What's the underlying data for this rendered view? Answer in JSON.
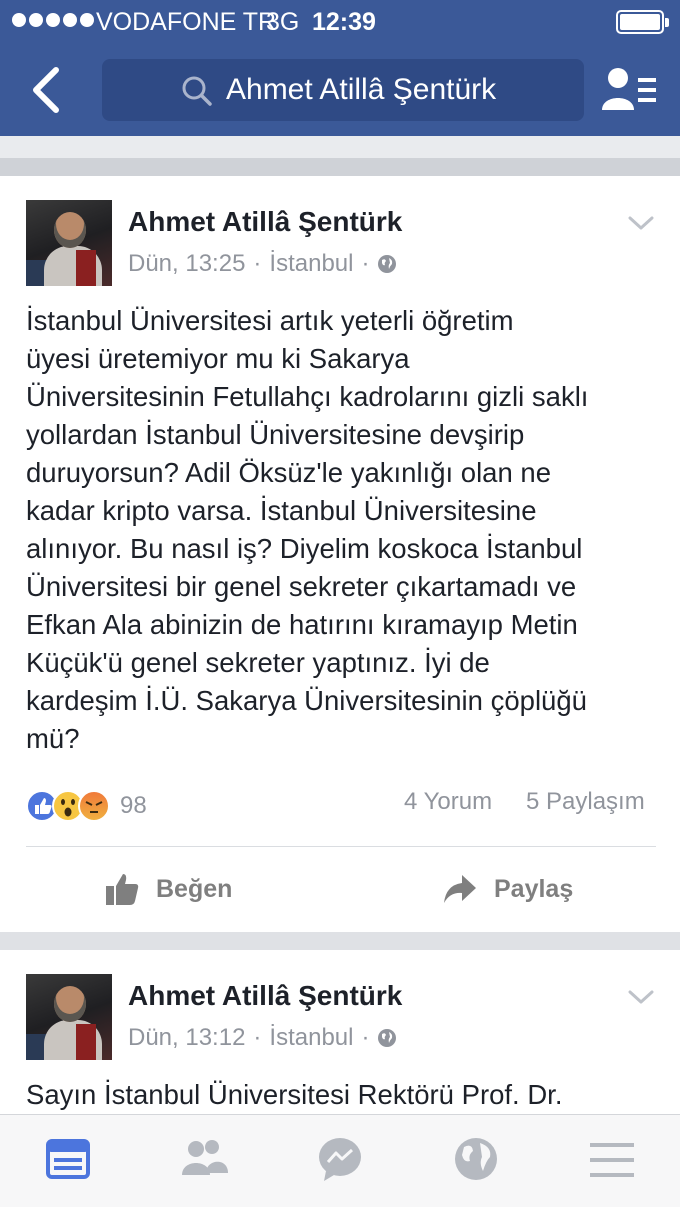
{
  "status_bar": {
    "carrier": "VODAFONE TR",
    "network": "3G",
    "time": "12:39"
  },
  "header": {
    "search_query": "Ahmet Atillâ Şentürk"
  },
  "posts": [
    {
      "author": "Ahmet Atillâ Şentürk",
      "time": "Dün, 13:25",
      "location": "İstanbul",
      "text": "İstanbul Üniversitesi artık yeterli öğretim\nüyesi üretemiyor mu ki Sakarya\nÜniversitesinin Fetullahçı kadrolarını gizli saklı\nyollardan İstanbul Üniversitesine devşirip\nduruyorsun? Adil Öksüz'le yakınlığı olan ne\nkadar kripto varsa. İstanbul Üniversitesine\nalınıyor. Bu nasıl iş? Diyelim koskoca İstanbul\nÜniversitesi bir genel sekreter çıkartamadı ve\nEfkan Ala abinizin de hatırını kıramayıp Metin\nKüçük'ü genel sekreter yaptınız. İyi de\nkardeşim İ.Ü. Sakarya Üniversitesinin çöplüğü\nmü?",
      "reaction_count": "98",
      "comments": "4 Yorum",
      "shares": "5 Paylaşım",
      "like_label": "Beğen",
      "share_label": "Paylaş"
    },
    {
      "author": "Ahmet Atillâ Şentürk",
      "time": "Dün, 13:12",
      "location": "İstanbul",
      "text": "Sayın İstanbul Üniversitesi Rektörü Prof. Dr."
    }
  ],
  "colors": {
    "brand": "#3b5998",
    "like_reaction": "#4c75dd",
    "nav_active": "#4c75dd"
  },
  "bottom_nav": [
    "news-feed-icon",
    "friends-icon",
    "messenger-icon",
    "notifications-globe-icon",
    "menu-icon"
  ]
}
